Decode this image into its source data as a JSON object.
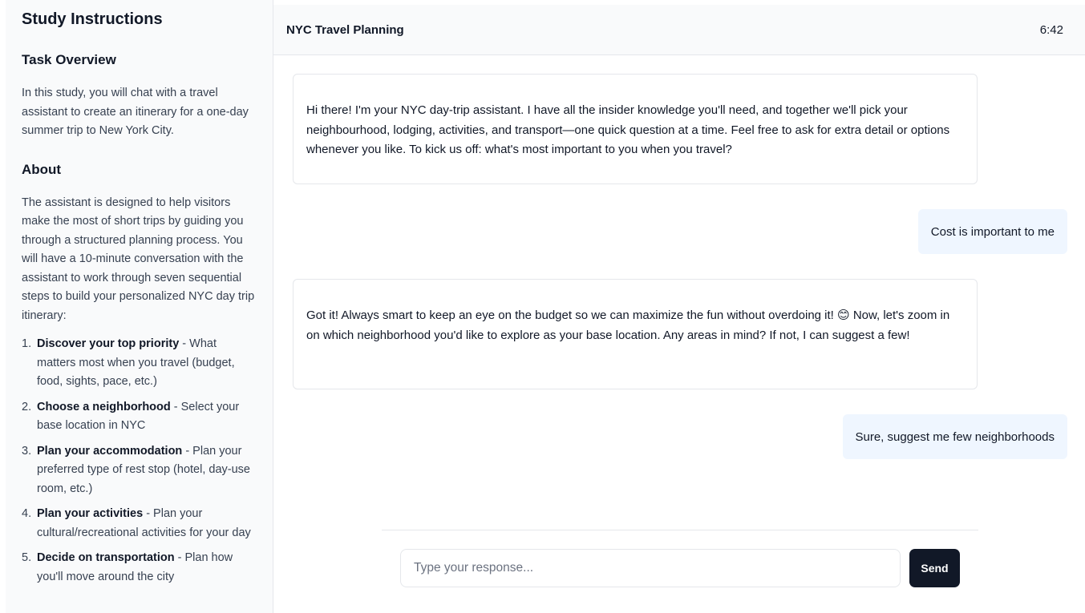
{
  "sidebar": {
    "title": "Study Instructions",
    "overview_heading": "Task Overview",
    "overview_text": "In this study, you will chat with a travel assistant to create an itinerary for a one-day summer trip to New York City.",
    "about_heading": "About",
    "about_text": "The assistant is designed to help visitors make the most of short trips by guiding you through a structured planning process. You will have a 10-minute conversation with the assistant to work through seven sequential steps to build your personalized NYC day trip itinerary:",
    "steps": [
      {
        "num": "1.",
        "title": "Discover your top priority",
        "desc": " - What matters most when you travel (budget, food, sights, pace, etc.)"
      },
      {
        "num": "2.",
        "title": "Choose a neighborhood",
        "desc": " - Select your base location in NYC"
      },
      {
        "num": "3.",
        "title": "Plan your accommodation",
        "desc": " - Plan your preferred type of rest stop (hotel, day-use room, etc.)"
      },
      {
        "num": "4.",
        "title": "Plan your activities",
        "desc": " - Plan your cultural/recreational activities for your day"
      },
      {
        "num": "5.",
        "title": "Decide on transportation",
        "desc": " - Plan how you'll move around the city"
      }
    ]
  },
  "header": {
    "title": "NYC Travel Planning",
    "timer": "6:42"
  },
  "messages": [
    {
      "role": "assistant",
      "text": "Hi there! I'm your NYC day-trip assistant. I have all the insider knowledge you'll need, and together we'll pick your neighbourhood, lodging, activities, and transport—one quick question at a time. Feel free to ask for extra detail or options whenever you like. To kick us off: what's most important to you when you travel?"
    },
    {
      "role": "user",
      "text": "Cost is important to me"
    },
    {
      "role": "assistant",
      "text": "Got it! Always smart to keep an eye on the budget so we can maximize the fun without overdoing it! 😊 Now, let's zoom in on which neighborhood you'd like to explore as your base location. Any areas in mind? If not, I can suggest a few!"
    },
    {
      "role": "user",
      "text": "Sure, suggest me few neighborhoods"
    }
  ],
  "composer": {
    "placeholder": "Type your response...",
    "value": "",
    "send_label": "Send"
  }
}
